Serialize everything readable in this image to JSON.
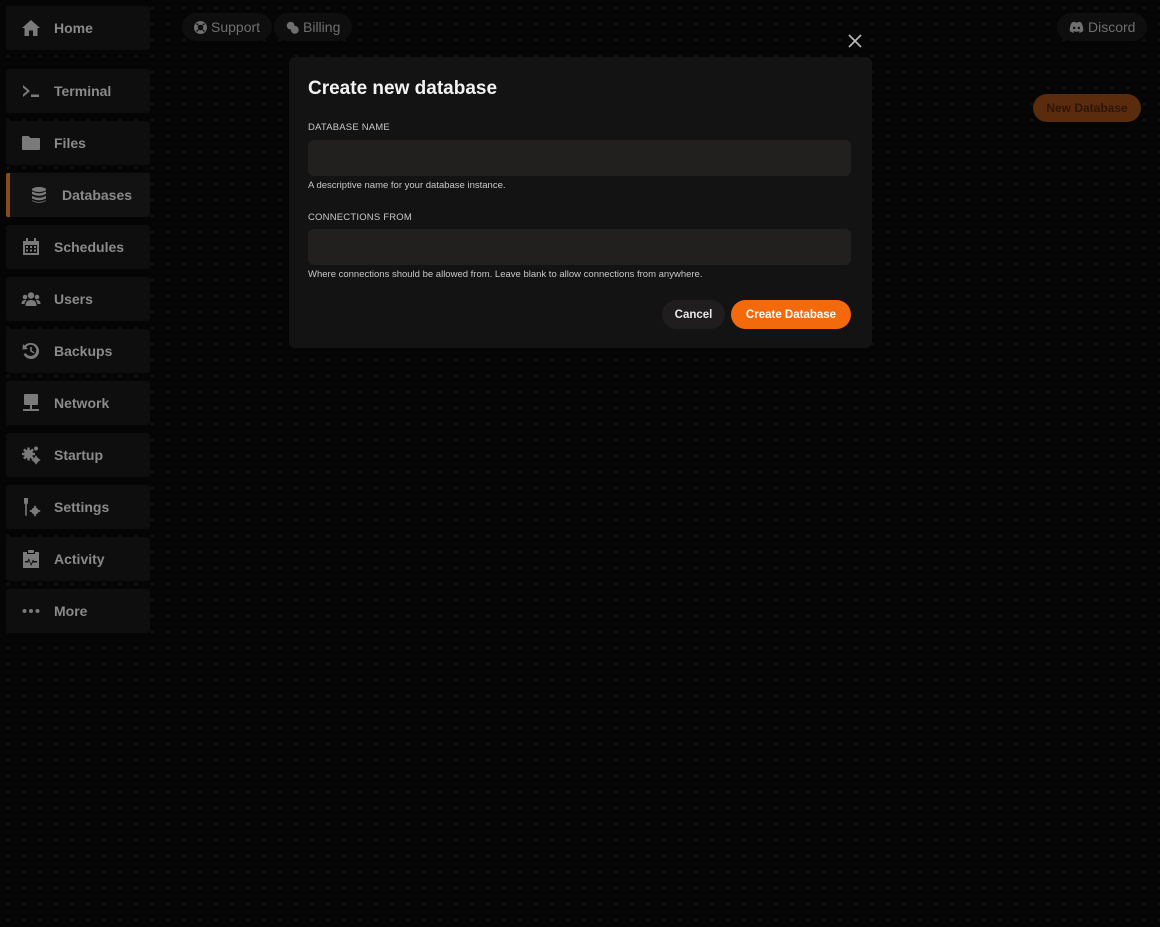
{
  "sidebar": {
    "items": [
      {
        "label": "Home",
        "icon": "home-icon"
      },
      {
        "label": "Terminal",
        "icon": "terminal-icon"
      },
      {
        "label": "Files",
        "icon": "folder-icon"
      },
      {
        "label": "Databases",
        "icon": "database-icon",
        "active": true
      },
      {
        "label": "Schedules",
        "icon": "calendar-icon"
      },
      {
        "label": "Users",
        "icon": "users-icon"
      },
      {
        "label": "Backups",
        "icon": "backup-icon"
      },
      {
        "label": "Network",
        "icon": "network-icon"
      },
      {
        "label": "Startup",
        "icon": "gears-icon"
      },
      {
        "label": "Settings",
        "icon": "tools-icon"
      },
      {
        "label": "Activity",
        "icon": "activity-icon"
      },
      {
        "label": "More",
        "icon": "ellipsis-icon"
      }
    ]
  },
  "header": {
    "support_label": "Support",
    "billing_label": "Billing",
    "discord_label": "Discord"
  },
  "main": {
    "new_database_label": "New Database"
  },
  "modal": {
    "title": "Create new database",
    "fields": [
      {
        "label": "DATABASE NAME",
        "value": "",
        "help": "A descriptive name for your database instance."
      },
      {
        "label": "CONNECTIONS FROM",
        "value": "",
        "help": "Where connections should be allowed from. Leave blank to allow connections from anywhere."
      }
    ],
    "cancel_label": "Cancel",
    "create_label": "Create Database"
  },
  "colors": {
    "accent": "#f36a0c",
    "background": "#050505",
    "modal_background": "#141313"
  }
}
